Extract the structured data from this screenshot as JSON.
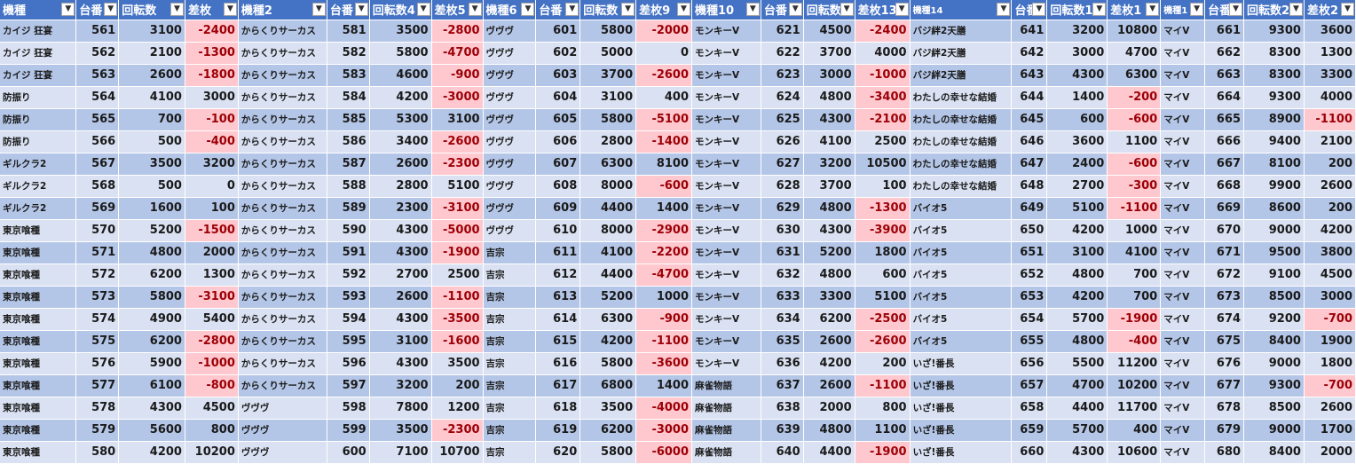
{
  "sheet": {
    "headers": [
      "機種",
      "台番",
      "回転数",
      "差枚",
      "機種2",
      "台番",
      "回転数4",
      "差枚5",
      "機種6",
      "台番",
      "回転数",
      "差枚9",
      "機種10",
      "台番",
      "回転数",
      "差枚13",
      "機種14",
      "台番",
      "回転数1",
      "差枚1",
      "機種1",
      "台番",
      "回転数2",
      "差枚2"
    ],
    "filter_icon": "filter-dropdown-icon",
    "negative_fill_color": "#ffc7ce",
    "negative_text_color": "#9c0006",
    "header_color": "#4472c4",
    "band_colors": [
      "#b4c6e7",
      "#d9e1f2"
    ],
    "rows": [
      [
        "カイジ 狂宴",
        "561",
        "3100",
        "-2400",
        "からくりサーカス",
        "581",
        "3500",
        "-2800",
        "ヴヴヴ",
        "601",
        "5800",
        "-2000",
        "モンキーV",
        "621",
        "4500",
        "-2400",
        "バジ絆2天膳",
        "641",
        "3200",
        "10800",
        "マイV",
        "661",
        "9300",
        "3600"
      ],
      [
        "カイジ 狂宴",
        "562",
        "2100",
        "-1300",
        "からくりサーカス",
        "582",
        "5800",
        "-4700",
        "ヴヴヴ",
        "602",
        "5000",
        "0",
        "モンキーV",
        "622",
        "3700",
        "4000",
        "バジ絆2天膳",
        "642",
        "3000",
        "4700",
        "マイV",
        "662",
        "8300",
        "1300"
      ],
      [
        "カイジ 狂宴",
        "563",
        "2600",
        "-1800",
        "からくりサーカス",
        "583",
        "4600",
        "-900",
        "ヴヴヴ",
        "603",
        "3700",
        "-2600",
        "モンキーV",
        "623",
        "3000",
        "-1000",
        "バジ絆2天膳",
        "643",
        "4300",
        "6300",
        "マイV",
        "663",
        "8300",
        "3300"
      ],
      [
        "防振り",
        "564",
        "4100",
        "3000",
        "からくりサーカス",
        "584",
        "4200",
        "-3000",
        "ヴヴヴ",
        "604",
        "3100",
        "400",
        "モンキーV",
        "624",
        "4800",
        "-3400",
        "わたしの幸せな結婚",
        "644",
        "1400",
        "-200",
        "マイV",
        "664",
        "9300",
        "4000"
      ],
      [
        "防振り",
        "565",
        "700",
        "-100",
        "からくりサーカス",
        "585",
        "5300",
        "3100",
        "ヴヴヴ",
        "605",
        "5800",
        "-5100",
        "モンキーV",
        "625",
        "4300",
        "-2100",
        "わたしの幸せな結婚",
        "645",
        "600",
        "-600",
        "マイV",
        "665",
        "8900",
        "-1100"
      ],
      [
        "防振り",
        "566",
        "500",
        "-400",
        "からくりサーカス",
        "586",
        "3400",
        "-2600",
        "ヴヴヴ",
        "606",
        "2800",
        "-1400",
        "モンキーV",
        "626",
        "4100",
        "2500",
        "わたしの幸せな結婚",
        "646",
        "3600",
        "1100",
        "マイV",
        "666",
        "9400",
        "2100"
      ],
      [
        "ギルクラ2",
        "567",
        "3500",
        "3200",
        "からくりサーカス",
        "587",
        "2600",
        "-2300",
        "ヴヴヴ",
        "607",
        "6300",
        "8100",
        "モンキーV",
        "627",
        "3200",
        "10500",
        "わたしの幸せな結婚",
        "647",
        "2400",
        "-600",
        "マイV",
        "667",
        "8100",
        "200"
      ],
      [
        "ギルクラ2",
        "568",
        "500",
        "0",
        "からくりサーカス",
        "588",
        "2800",
        "5100",
        "ヴヴヴ",
        "608",
        "8000",
        "-600",
        "モンキーV",
        "628",
        "3700",
        "100",
        "わたしの幸せな結婚",
        "648",
        "2700",
        "-300",
        "マイV",
        "668",
        "9900",
        "2600"
      ],
      [
        "ギルクラ2",
        "569",
        "1600",
        "100",
        "からくりサーカス",
        "589",
        "2300",
        "-3100",
        "ヴヴヴ",
        "609",
        "4400",
        "1400",
        "モンキーV",
        "629",
        "4800",
        "-1300",
        "バイオ5",
        "649",
        "5100",
        "-1100",
        "マイV",
        "669",
        "8600",
        "200"
      ],
      [
        "東京喰種",
        "570",
        "5200",
        "-1500",
        "からくりサーカス",
        "590",
        "4300",
        "-5000",
        "ヴヴヴ",
        "610",
        "8000",
        "-2900",
        "モンキーV",
        "630",
        "4300",
        "-3900",
        "バイオ5",
        "650",
        "4200",
        "1000",
        "マイV",
        "670",
        "9000",
        "4200"
      ],
      [
        "東京喰種",
        "571",
        "4800",
        "2000",
        "からくりサーカス",
        "591",
        "4300",
        "-1900",
        "吉宗",
        "611",
        "4100",
        "-2200",
        "モンキーV",
        "631",
        "5200",
        "1800",
        "バイオ5",
        "651",
        "3100",
        "4100",
        "マイV",
        "671",
        "9500",
        "3800"
      ],
      [
        "東京喰種",
        "572",
        "6200",
        "1300",
        "からくりサーカス",
        "592",
        "2700",
        "2500",
        "吉宗",
        "612",
        "4400",
        "-4700",
        "モンキーV",
        "632",
        "4800",
        "600",
        "バイオ5",
        "652",
        "4800",
        "700",
        "マイV",
        "672",
        "9100",
        "4500"
      ],
      [
        "東京喰種",
        "573",
        "5800",
        "-3100",
        "からくりサーカス",
        "593",
        "2600",
        "-1100",
        "吉宗",
        "613",
        "5200",
        "1000",
        "モンキーV",
        "633",
        "3300",
        "5100",
        "バイオ5",
        "653",
        "4200",
        "700",
        "マイV",
        "673",
        "8500",
        "3000"
      ],
      [
        "東京喰種",
        "574",
        "4900",
        "5400",
        "からくりサーカス",
        "594",
        "4300",
        "-3500",
        "吉宗",
        "614",
        "6300",
        "-900",
        "モンキーV",
        "634",
        "6200",
        "-2500",
        "バイオ5",
        "654",
        "5700",
        "-1900",
        "マイV",
        "674",
        "9200",
        "-700"
      ],
      [
        "東京喰種",
        "575",
        "6200",
        "-2800",
        "からくりサーカス",
        "595",
        "3100",
        "-1600",
        "吉宗",
        "615",
        "4200",
        "-1100",
        "モンキーV",
        "635",
        "2600",
        "-2600",
        "バイオ5",
        "655",
        "4800",
        "-400",
        "マイV",
        "675",
        "8400",
        "1900"
      ],
      [
        "東京喰種",
        "576",
        "5900",
        "-1000",
        "からくりサーカス",
        "596",
        "4300",
        "3500",
        "吉宗",
        "616",
        "5800",
        "-3600",
        "モンキーV",
        "636",
        "4200",
        "200",
        "いざ!番長",
        "656",
        "5500",
        "11200",
        "マイV",
        "676",
        "9000",
        "1800"
      ],
      [
        "東京喰種",
        "577",
        "6100",
        "-800",
        "からくりサーカス",
        "597",
        "3200",
        "200",
        "吉宗",
        "617",
        "6800",
        "1400",
        "麻雀物語",
        "637",
        "2600",
        "-1100",
        "いざ!番長",
        "657",
        "4700",
        "10200",
        "マイV",
        "677",
        "9300",
        "-700"
      ],
      [
        "東京喰種",
        "578",
        "4300",
        "4500",
        "ヴヴヴ",
        "598",
        "7800",
        "1200",
        "吉宗",
        "618",
        "3500",
        "-4000",
        "麻雀物語",
        "638",
        "2000",
        "800",
        "いざ!番長",
        "658",
        "4400",
        "11700",
        "マイV",
        "678",
        "8500",
        "2600"
      ],
      [
        "東京喰種",
        "579",
        "5600",
        "800",
        "ヴヴヴ",
        "599",
        "3500",
        "-2300",
        "吉宗",
        "619",
        "6200",
        "-3000",
        "麻雀物語",
        "639",
        "4800",
        "1100",
        "いざ!番長",
        "659",
        "5700",
        "400",
        "マイV",
        "679",
        "9000",
        "1700"
      ],
      [
        "東京喰種",
        "580",
        "4200",
        "10200",
        "ヴヴヴ",
        "600",
        "7100",
        "10700",
        "吉宗",
        "620",
        "5800",
        "-6000",
        "麻雀物語",
        "640",
        "4400",
        "-1900",
        "いざ!番長",
        "660",
        "4300",
        "10600",
        "マイV",
        "680",
        "8400",
        "2000"
      ]
    ]
  }
}
